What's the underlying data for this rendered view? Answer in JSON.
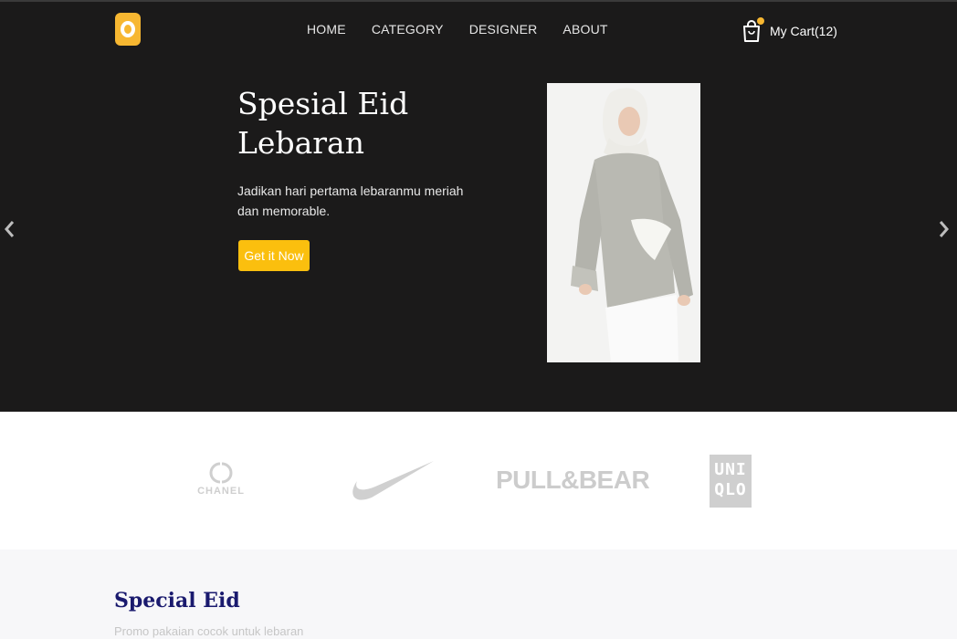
{
  "nav": {
    "items": [
      "HOME",
      "CATEGORY",
      "DESIGNER",
      "ABOUT"
    ],
    "cart_label": "My Cart(12)"
  },
  "hero": {
    "title": "Spesial Eid Lebaran",
    "description": "Jadikan hari pertama lebaranmu meriah dan memorable.",
    "button_label": "Get it Now"
  },
  "brands": {
    "chanel": "CHANEL",
    "pull_and_bear": "PULL&BEAR",
    "uniqlo_line1": "UNI",
    "uniqlo_line2": "QLO"
  },
  "special": {
    "title": "Special Eid",
    "subtitle": "Promo pakaian cocok untuk lebaran"
  },
  "colors": {
    "hero_bg": "#1b1a1a",
    "accent": "#fbbf0e",
    "title_navy": "#1a1a6e",
    "section_bg": "#f7f7f9"
  },
  "icons": [
    "logo-icon",
    "shopping-bag-icon",
    "chevron-left-icon",
    "chevron-right-icon",
    "chanel-logo",
    "nike-swoosh-logo",
    "uniqlo-logo"
  ]
}
